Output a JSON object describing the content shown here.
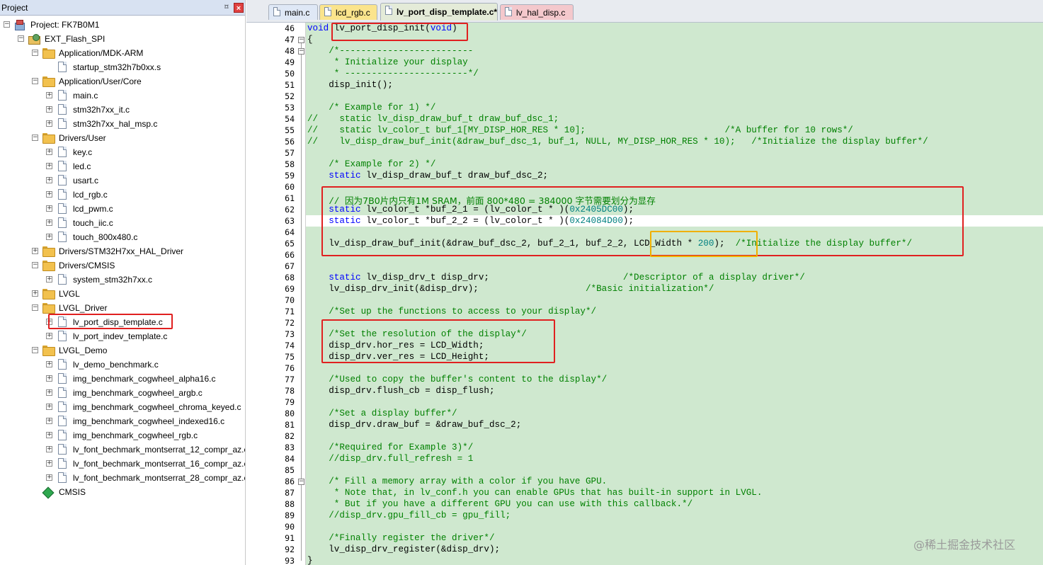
{
  "project_pane": {
    "title": "Project",
    "pin": "⌑",
    "close": "×",
    "tree": [
      {
        "label": "Project: FK7B0M1",
        "level": 0,
        "icon": "project",
        "exp": "-"
      },
      {
        "label": "EXT_Flash_SPI",
        "level": 1,
        "icon": "target",
        "exp": "-"
      },
      {
        "label": "Application/MDK-ARM",
        "level": 2,
        "icon": "folder",
        "exp": "-"
      },
      {
        "label": "startup_stm32h7b0xx.s",
        "level": 3,
        "icon": "file",
        "exp": ""
      },
      {
        "label": "Application/User/Core",
        "level": 2,
        "icon": "folder",
        "exp": "-"
      },
      {
        "label": "main.c",
        "level": 3,
        "icon": "file",
        "exp": "+"
      },
      {
        "label": "stm32h7xx_it.c",
        "level": 3,
        "icon": "file",
        "exp": "+"
      },
      {
        "label": "stm32h7xx_hal_msp.c",
        "level": 3,
        "icon": "file",
        "exp": "+"
      },
      {
        "label": "Drivers/User",
        "level": 2,
        "icon": "folder",
        "exp": "-"
      },
      {
        "label": "key.c",
        "level": 3,
        "icon": "file",
        "exp": "+"
      },
      {
        "label": "led.c",
        "level": 3,
        "icon": "file",
        "exp": "+"
      },
      {
        "label": "usart.c",
        "level": 3,
        "icon": "file",
        "exp": "+"
      },
      {
        "label": "lcd_rgb.c",
        "level": 3,
        "icon": "file",
        "exp": "+"
      },
      {
        "label": "lcd_pwm.c",
        "level": 3,
        "icon": "file",
        "exp": "+"
      },
      {
        "label": "touch_iic.c",
        "level": 3,
        "icon": "file",
        "exp": "+"
      },
      {
        "label": "touch_800x480.c",
        "level": 3,
        "icon": "file",
        "exp": "+"
      },
      {
        "label": "Drivers/STM32H7xx_HAL_Driver",
        "level": 2,
        "icon": "folder",
        "exp": "+"
      },
      {
        "label": "Drivers/CMSIS",
        "level": 2,
        "icon": "folder",
        "exp": "-"
      },
      {
        "label": "system_stm32h7xx.c",
        "level": 3,
        "icon": "file",
        "exp": "+"
      },
      {
        "label": "LVGL",
        "level": 2,
        "icon": "folder",
        "exp": "+"
      },
      {
        "label": "LVGL_Driver",
        "level": 2,
        "icon": "folder",
        "exp": "-"
      },
      {
        "label": "lv_port_disp_template.c",
        "level": 3,
        "icon": "file",
        "exp": "+"
      },
      {
        "label": "lv_port_indev_template.c",
        "level": 3,
        "icon": "file",
        "exp": "+"
      },
      {
        "label": "LVGL_Demo",
        "level": 2,
        "icon": "folder",
        "exp": "-"
      },
      {
        "label": "lv_demo_benchmark.c",
        "level": 3,
        "icon": "file",
        "exp": "+"
      },
      {
        "label": "img_benchmark_cogwheel_alpha16.c",
        "level": 3,
        "icon": "file",
        "exp": "+"
      },
      {
        "label": "img_benchmark_cogwheel_argb.c",
        "level": 3,
        "icon": "file",
        "exp": "+"
      },
      {
        "label": "img_benchmark_cogwheel_chroma_keyed.c",
        "level": 3,
        "icon": "file",
        "exp": "+"
      },
      {
        "label": "img_benchmark_cogwheel_indexed16.c",
        "level": 3,
        "icon": "file",
        "exp": "+"
      },
      {
        "label": "img_benchmark_cogwheel_rgb.c",
        "level": 3,
        "icon": "file",
        "exp": "+"
      },
      {
        "label": "lv_font_bechmark_montserrat_12_compr_az.c.",
        "level": 3,
        "icon": "file",
        "exp": "+"
      },
      {
        "label": "lv_font_bechmark_montserrat_16_compr_az.c.",
        "level": 3,
        "icon": "file",
        "exp": "+"
      },
      {
        "label": "lv_font_bechmark_montserrat_28_compr_az.c.",
        "level": 3,
        "icon": "file",
        "exp": "+"
      },
      {
        "label": "CMSIS",
        "level": 2,
        "icon": "gem",
        "exp": ""
      }
    ]
  },
  "tabs": [
    {
      "label": "main.c"
    },
    {
      "label": "lcd_rgb.c"
    },
    {
      "label": "lv_port_disp_template.c*"
    },
    {
      "label": "lv_hal_disp.c"
    }
  ],
  "editor": {
    "lines": [
      {
        "n": "46",
        "segs": [
          [
            "kw",
            "void "
          ],
          [
            "",
            "lv_port_disp_init("
          ],
          [
            "kw",
            "void"
          ],
          [
            "",
            ")"
          ]
        ]
      },
      {
        "n": "47",
        "segs": [
          [
            "",
            "{"
          ]
        ]
      },
      {
        "n": "48",
        "segs": [
          [
            "cm",
            "    /*-------------------------"
          ]
        ]
      },
      {
        "n": "49",
        "segs": [
          [
            "cm",
            "     * Initialize your display"
          ]
        ]
      },
      {
        "n": "50",
        "segs": [
          [
            "cm",
            "     * -----------------------*/"
          ]
        ]
      },
      {
        "n": "51",
        "segs": [
          [
            "",
            "    disp_init();"
          ]
        ]
      },
      {
        "n": "52",
        "segs": []
      },
      {
        "n": "53",
        "segs": [
          [
            "cm",
            "    /* Example for 1) */"
          ]
        ]
      },
      {
        "n": "54",
        "segs": [
          [
            "cm",
            "//    static lv_disp_draw_buf_t draw_buf_dsc_1;"
          ]
        ]
      },
      {
        "n": "55",
        "segs": [
          [
            "cm",
            "//    static lv_color_t buf_1[MY_DISP_HOR_RES * 10];                          /*A buffer for 10 rows*/"
          ]
        ]
      },
      {
        "n": "56",
        "segs": [
          [
            "cm",
            "//    lv_disp_draw_buf_init(&draw_buf_dsc_1, buf_1, NULL, MY_DISP_HOR_RES * 10);   /*Initialize the display buffer*/"
          ]
        ]
      },
      {
        "n": "57",
        "segs": []
      },
      {
        "n": "58",
        "segs": [
          [
            "cm",
            "    /* Example for 2) */"
          ]
        ]
      },
      {
        "n": "59",
        "segs": [
          [
            "kw",
            "    static "
          ],
          [
            "",
            "lv_disp_draw_buf_t draw_buf_dsc_2;"
          ]
        ]
      },
      {
        "n": "60",
        "segs": []
      },
      {
        "n": "61",
        "segs": [
          [
            "cm",
            "    // "
          ],
          [
            "cm cn",
            "因为7B0片内只有1M SRAM，前面 800*480 = 384000 字节需要划分为显存"
          ]
        ]
      },
      {
        "n": "62",
        "segs": [
          [
            "kw",
            "    static "
          ],
          [
            "",
            "lv_color_t *buf_2_1 = (lv_color_t * )("
          ],
          [
            "num",
            "0x2405DC00"
          ],
          [
            "",
            ");"
          ]
        ]
      },
      {
        "n": "63",
        "segs": [
          [
            "kw",
            "    static "
          ],
          [
            "",
            "lv_color_t *buf_2_2 = (lv_color_t * )("
          ],
          [
            "num",
            "0x24084D00"
          ],
          [
            "",
            ");"
          ]
        ]
      },
      {
        "n": "64",
        "segs": []
      },
      {
        "n": "65",
        "segs": [
          [
            "",
            "    lv_disp_draw_buf_init(&draw_buf_dsc_2, buf_2_1, buf_2_2, LCD_Width * "
          ],
          [
            "num",
            "200"
          ],
          [
            "",
            ");  "
          ],
          [
            "cm",
            "/*Initialize the display buffer*/"
          ]
        ]
      },
      {
        "n": "66",
        "segs": []
      },
      {
        "n": "67",
        "segs": []
      },
      {
        "n": "68",
        "segs": [
          [
            "kw",
            "    static "
          ],
          [
            "",
            "lv_disp_drv_t disp_drv;                         "
          ],
          [
            "cm",
            "/*Descriptor of a display driver*/"
          ]
        ]
      },
      {
        "n": "69",
        "segs": [
          [
            "",
            "    lv_disp_drv_init(&disp_drv);                    "
          ],
          [
            "cm",
            "/*Basic initialization*/"
          ]
        ]
      },
      {
        "n": "70",
        "segs": []
      },
      {
        "n": "71",
        "segs": [
          [
            "cm",
            "    /*Set up the functions to access to your display*/"
          ]
        ]
      },
      {
        "n": "72",
        "segs": []
      },
      {
        "n": "73",
        "segs": [
          [
            "cm",
            "    /*Set the resolution of the display*/"
          ]
        ]
      },
      {
        "n": "74",
        "segs": [
          [
            "",
            "    disp_drv.hor_res = LCD_Width;"
          ]
        ]
      },
      {
        "n": "75",
        "segs": [
          [
            "",
            "    disp_drv.ver_res = LCD_Height;"
          ]
        ]
      },
      {
        "n": "76",
        "segs": []
      },
      {
        "n": "77",
        "segs": [
          [
            "cm",
            "    /*Used to copy the buffer's content to the display*/"
          ]
        ]
      },
      {
        "n": "78",
        "segs": [
          [
            "",
            "    disp_drv.flush_cb = disp_flush;"
          ]
        ]
      },
      {
        "n": "79",
        "segs": []
      },
      {
        "n": "80",
        "segs": [
          [
            "cm",
            "    /*Set a display buffer*/"
          ]
        ]
      },
      {
        "n": "81",
        "segs": [
          [
            "",
            "    disp_drv.draw_buf = &draw_buf_dsc_2;"
          ]
        ]
      },
      {
        "n": "82",
        "segs": []
      },
      {
        "n": "83",
        "segs": [
          [
            "cm",
            "    /*Required for Example 3)*/"
          ]
        ]
      },
      {
        "n": "84",
        "segs": [
          [
            "cm",
            "    //disp_drv.full_refresh = 1"
          ]
        ]
      },
      {
        "n": "85",
        "segs": []
      },
      {
        "n": "86",
        "segs": [
          [
            "cm",
            "    /* Fill a memory array with a color if you have GPU."
          ]
        ]
      },
      {
        "n": "87",
        "segs": [
          [
            "cm",
            "     * Note that, in lv_conf.h you can enable GPUs that has built-in support in LVGL."
          ]
        ]
      },
      {
        "n": "88",
        "segs": [
          [
            "cm",
            "     * But if you have a different GPU you can use with this callback.*/"
          ]
        ]
      },
      {
        "n": "89",
        "segs": [
          [
            "cm",
            "    //disp_drv.gpu_fill_cb = gpu_fill;"
          ]
        ]
      },
      {
        "n": "90",
        "segs": []
      },
      {
        "n": "91",
        "segs": [
          [
            "cm",
            "    /*Finally register the driver*/"
          ]
        ]
      },
      {
        "n": "92",
        "segs": [
          [
            "",
            "    lv_disp_drv_register(&disp_drv);"
          ]
        ]
      },
      {
        "n": "93",
        "segs": [
          [
            "",
            "}"
          ]
        ]
      }
    ]
  },
  "watermark": "@稀土掘金技术社区",
  "colors": {
    "keyword": "#0000ff",
    "comment": "#008000",
    "number": "#008080",
    "code_bg": "#cfe8cf",
    "highlight_red": "#e02020",
    "highlight_orange": "#f0b000"
  }
}
